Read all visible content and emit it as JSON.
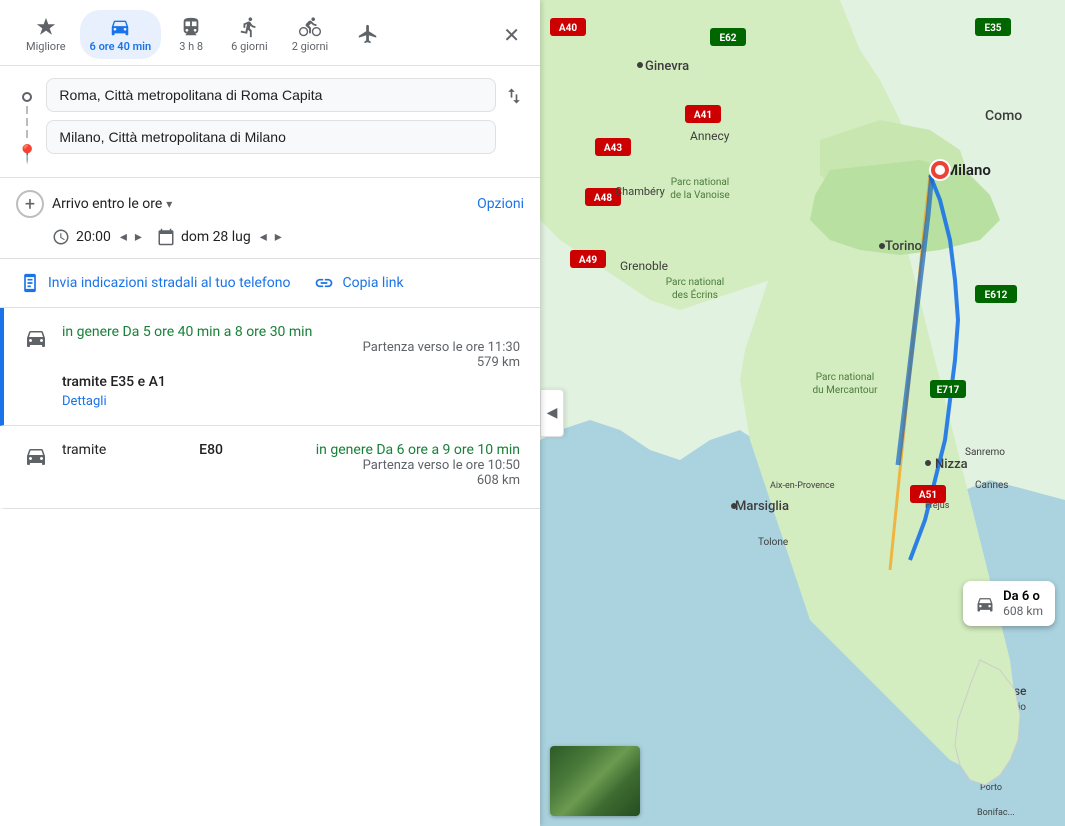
{
  "transport_modes": [
    {
      "id": "best",
      "icon": "diamond",
      "label": "Migliore",
      "active": false
    },
    {
      "id": "car",
      "icon": "car",
      "label": "6 ore 40 min",
      "sublabel": "",
      "active": true
    },
    {
      "id": "transit",
      "icon": "bus",
      "label": "3 h 8",
      "active": false
    },
    {
      "id": "walk",
      "icon": "walk",
      "label": "6 giorni",
      "active": false
    },
    {
      "id": "bike",
      "icon": "bike",
      "label": "2 giorni",
      "active": false
    },
    {
      "id": "flight",
      "icon": "plane",
      "label": "",
      "active": false
    }
  ],
  "origin": "Roma, Città metropolitana di Roma Capita",
  "destination": "Milano, Città metropolitana di Milano",
  "arrive_label": "Arrivo entro le ore",
  "options_label": "Opzioni",
  "time_value": "20:00",
  "date_value": "dom 28 lug",
  "share": {
    "send_label": "Invia indicazioni stradali al tuo telefono",
    "copy_label": "Copia link"
  },
  "routes": [
    {
      "id": 1,
      "selected": true,
      "duration_text": "in genere Da 5 ore 40 min a 8 ore 30 min",
      "departure": "Partenza verso le ore 11:30",
      "distance": "579 km",
      "via": "tramite E35 e A1",
      "details_label": "Dettagli"
    },
    {
      "id": 2,
      "selected": false,
      "via_prefix": "tramite",
      "via_road": "E80",
      "duration_text": "in genere Da 6 ore a 9 ore 10 min",
      "departure": "Partenza verso le ore 10:50",
      "distance": "608 km",
      "details_label": ""
    }
  ],
  "map_card": {
    "label": "Da 6 o",
    "distance": "608 km"
  },
  "collapse_icon": "◀"
}
